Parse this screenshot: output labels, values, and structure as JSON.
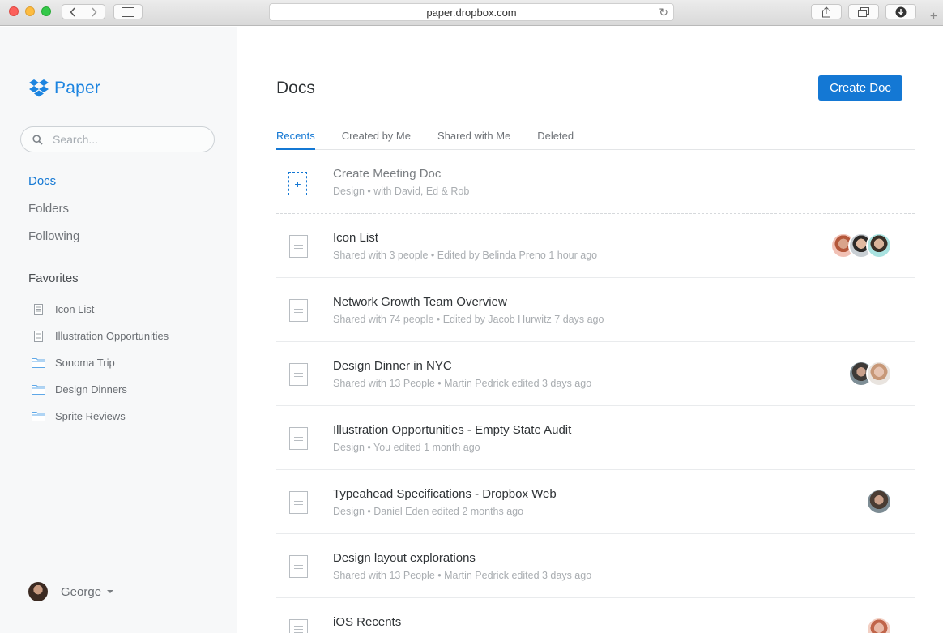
{
  "browser": {
    "url": "paper.dropbox.com"
  },
  "sidebar": {
    "logo_text": "Paper",
    "search_placeholder": "Search...",
    "nav": [
      {
        "label": "Docs",
        "active": true
      },
      {
        "label": "Folders",
        "active": false
      },
      {
        "label": "Following",
        "active": false
      }
    ],
    "favorites_title": "Favorites",
    "favorites": [
      {
        "label": "Icon List",
        "icon": "doc-icon"
      },
      {
        "label": "Illustration Opportunities",
        "icon": "doc-icon"
      },
      {
        "label": "Sonoma Trip",
        "icon": "folder-icon"
      },
      {
        "label": "Design Dinners",
        "icon": "folder-icon"
      },
      {
        "label": "Sprite Reviews",
        "icon": "folder-icon"
      }
    ],
    "user_name": "George"
  },
  "main": {
    "title": "Docs",
    "create_button": "Create Doc",
    "tabs": [
      {
        "label": "Recents",
        "active": true
      },
      {
        "label": "Created by Me",
        "active": false
      },
      {
        "label": "Shared with Me",
        "active": false
      },
      {
        "label": "Deleted",
        "active": false
      }
    ],
    "meeting": {
      "title": "Create Meeting Doc",
      "subtitle": "Design • with David, Ed & Rob"
    },
    "docs": [
      {
        "title": "Icon List",
        "subtitle": "Shared with 3 people • Edited by Belinda Preno 1 hour ago",
        "avatars": 3
      },
      {
        "title": "Network Growth Team Overview",
        "subtitle": "Shared with 74 people • Edited by Jacob Hurwitz 7 days ago",
        "avatars": 0
      },
      {
        "title": "Design Dinner in NYC",
        "subtitle": "Shared with 13 People • Martin Pedrick edited 3 days ago",
        "avatars": 2
      },
      {
        "title": "Illustration Opportunities - Empty State Audit",
        "subtitle": "Design • You edited 1 month ago",
        "avatars": 0
      },
      {
        "title": "Typeahead Specifications - Dropbox Web",
        "subtitle": "Design • Daniel Eden edited 2 months ago",
        "avatars": 1
      },
      {
        "title": "Design layout explorations",
        "subtitle": "Shared with 13 People • Martin Pedrick edited 3 days ago",
        "avatars": 0
      },
      {
        "title": "iOS Recents",
        "subtitle": "",
        "avatars": 1
      }
    ]
  },
  "colors": {
    "accent": "#1478d4",
    "sidebar_bg": "#f7f8f9"
  }
}
